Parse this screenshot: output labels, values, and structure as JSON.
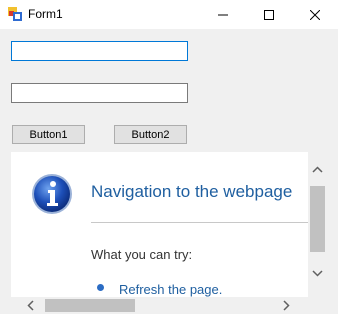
{
  "window": {
    "title": "Form1"
  },
  "form": {
    "button1_label": "Button1",
    "button2_label": "Button2"
  },
  "browser": {
    "heading": "Navigation to the webpage",
    "try_label": "What you can try:",
    "refresh_link": "Refresh the page."
  },
  "colors": {
    "accent": "#0078d7",
    "link": "#1f5fa0"
  }
}
